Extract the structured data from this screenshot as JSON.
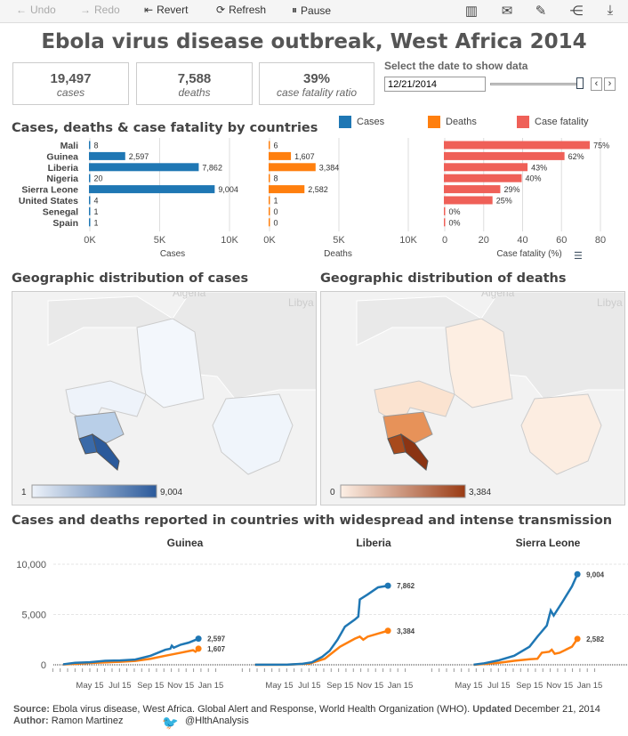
{
  "toolbar": {
    "undo": "Undo",
    "redo": "Redo",
    "revert": "Revert",
    "refresh": "Refresh",
    "pause": "Pause"
  },
  "title": "Ebola virus disease outbreak, West Africa 2014",
  "kpis": [
    {
      "value": "19,497",
      "label": "cases"
    },
    {
      "value": "7,588",
      "label": "deaths"
    },
    {
      "value": "39%",
      "label": "case fatality ratio"
    }
  ],
  "date_filter": {
    "label": "Select the date to show data",
    "value": "12/21/2014",
    "slider_position": 1.0
  },
  "bars": {
    "title": "Cases, deaths & case fatality by countries",
    "legend": [
      {
        "name": "Cases",
        "color": "#1f77b4"
      },
      {
        "name": "Deaths",
        "color": "#ff7f0e"
      },
      {
        "name": "Case fatality",
        "color": "#ef6058"
      }
    ],
    "countries": [
      "Mali",
      "Guinea",
      "Liberia",
      "Nigeria",
      "Sierra Leone",
      "United States",
      "Senegal",
      "Spain"
    ],
    "cases": [
      8,
      2597,
      7862,
      20,
      9004,
      4,
      1,
      1
    ],
    "cases_labels": [
      "8",
      "2,597",
      "7,862",
      "20",
      "9,004",
      "4",
      "1",
      "1"
    ],
    "deaths": [
      6,
      1607,
      3384,
      8,
      2582,
      1,
      0,
      0
    ],
    "deaths_labels": [
      "6",
      "1,607",
      "3,384",
      "8",
      "2,582",
      "1",
      "0",
      "0"
    ],
    "fatality": [
      75,
      62,
      43,
      40,
      29,
      25,
      0,
      0
    ],
    "fatality_labels": [
      "75%",
      "62%",
      "43%",
      "40%",
      "29%",
      "25%",
      "0%",
      "0%"
    ],
    "axes": {
      "cases": {
        "title": "Cases",
        "ticks": [
          "0K",
          "5K",
          "10K"
        ],
        "max": 10000
      },
      "deaths": {
        "title": "Deaths",
        "ticks": [
          "0K",
          "5K",
          "10K"
        ],
        "max": 10000
      },
      "fatality": {
        "title": "Case fatality (%)",
        "ticks": [
          "0",
          "20",
          "40",
          "60",
          "80"
        ],
        "max": 80
      }
    }
  },
  "maps": [
    {
      "title": "Geographic distribution of cases",
      "labels": [
        "Algeria",
        "Libya"
      ],
      "legend_min": "1",
      "legend_max": "9,004",
      "colors": [
        "#eef3fa",
        "#2b5a9b"
      ]
    },
    {
      "title": "Geographic distribution of deaths",
      "labels": [
        "Algeria",
        "Libya"
      ],
      "legend_min": "0",
      "legend_max": "3,384",
      "colors": [
        "#fdf0e6",
        "#9a3b14"
      ]
    }
  ],
  "lines": {
    "title": "Cases and deaths reported in countries with widespread and intense transmission",
    "y_ticks": [
      "10,000",
      "5,000",
      "0"
    ],
    "x_ticks": [
      "May 15",
      "Jul 15",
      "Sep 15",
      "Nov 15",
      "Jan 15"
    ],
    "panels": [
      {
        "country": "Guinea",
        "cases_label": "2,597",
        "deaths_label": "1,607",
        "cases": [
          [
            "2014-03-22",
            49
          ],
          [
            "2014-04-15",
            200
          ],
          [
            "2014-05-15",
            250
          ],
          [
            "2014-06-15",
            400
          ],
          [
            "2014-07-15",
            430
          ],
          [
            "2014-08-15",
            520
          ],
          [
            "2014-09-15",
            900
          ],
          [
            "2014-10-15",
            1500
          ],
          [
            "2014-10-25",
            1600
          ],
          [
            "2014-10-28",
            1900
          ],
          [
            "2014-11-01",
            1700
          ],
          [
            "2014-11-15",
            2000
          ],
          [
            "2014-12-01",
            2200
          ],
          [
            "2014-12-21",
            2597
          ]
        ],
        "deaths": [
          [
            "2014-03-22",
            29
          ],
          [
            "2014-05-15",
            180
          ],
          [
            "2014-07-15",
            300
          ],
          [
            "2014-08-15",
            390
          ],
          [
            "2014-09-15",
            600
          ],
          [
            "2014-10-15",
            900
          ],
          [
            "2014-11-15",
            1200
          ],
          [
            "2014-12-10",
            1450
          ],
          [
            "2014-12-15",
            1300
          ],
          [
            "2014-12-21",
            1607
          ]
        ]
      },
      {
        "country": "Liberia",
        "cases_label": "7,862",
        "deaths_label": "3,384",
        "cases": [
          [
            "2014-03-27",
            10
          ],
          [
            "2014-06-01",
            20
          ],
          [
            "2014-07-01",
            100
          ],
          [
            "2014-07-20",
            250
          ],
          [
            "2014-08-10",
            800
          ],
          [
            "2014-08-25",
            1400
          ],
          [
            "2014-09-10",
            2500
          ],
          [
            "2014-09-25",
            3800
          ],
          [
            "2014-10-15",
            4500
          ],
          [
            "2014-10-22",
            4800
          ],
          [
            "2014-10-25",
            6500
          ],
          [
            "2014-11-10",
            7000
          ],
          [
            "2014-12-01",
            7700
          ],
          [
            "2014-12-21",
            7862
          ]
        ],
        "deaths": [
          [
            "2014-03-27",
            5
          ],
          [
            "2014-06-01",
            10
          ],
          [
            "2014-07-15",
            120
          ],
          [
            "2014-08-15",
            600
          ],
          [
            "2014-09-15",
            1800
          ],
          [
            "2014-10-15",
            2600
          ],
          [
            "2014-10-25",
            2800
          ],
          [
            "2014-11-01",
            2500
          ],
          [
            "2014-11-10",
            2800
          ],
          [
            "2014-12-01",
            3100
          ],
          [
            "2014-12-21",
            3384
          ]
        ]
      },
      {
        "country": "Sierra Leone",
        "cases_label": "9,004",
        "deaths_label": "2,582",
        "cases": [
          [
            "2014-05-25",
            16
          ],
          [
            "2014-06-15",
            150
          ],
          [
            "2014-07-15",
            450
          ],
          [
            "2014-08-15",
            900
          ],
          [
            "2014-09-15",
            1800
          ],
          [
            "2014-10-01",
            2800
          ],
          [
            "2014-10-20",
            3900
          ],
          [
            "2014-10-28",
            5400
          ],
          [
            "2014-11-03",
            4900
          ],
          [
            "2014-11-20",
            6200
          ],
          [
            "2014-12-10",
            7800
          ],
          [
            "2014-12-21",
            9004
          ]
        ],
        "deaths": [
          [
            "2014-05-25",
            5
          ],
          [
            "2014-07-15",
            200
          ],
          [
            "2014-08-15",
            400
          ],
          [
            "2014-09-15",
            550
          ],
          [
            "2014-10-01",
            600
          ],
          [
            "2014-10-10",
            1200
          ],
          [
            "2014-10-25",
            1300
          ],
          [
            "2014-10-30",
            1500
          ],
          [
            "2014-11-05",
            1100
          ],
          [
            "2014-11-15",
            1200
          ],
          [
            "2014-12-10",
            1800
          ],
          [
            "2014-12-21",
            2582
          ]
        ]
      }
    ]
  },
  "footer": {
    "source_label": "Source:",
    "source_text": "Ebola virus disease, West Africa. Global Alert and Response, World Health Organization (WHO).",
    "updated_label": "Updated",
    "updated_text": "December 21, 2014",
    "author_label": "Author:",
    "author_text": "Ramon Martinez",
    "twitter": "@HlthAnalysis"
  }
}
